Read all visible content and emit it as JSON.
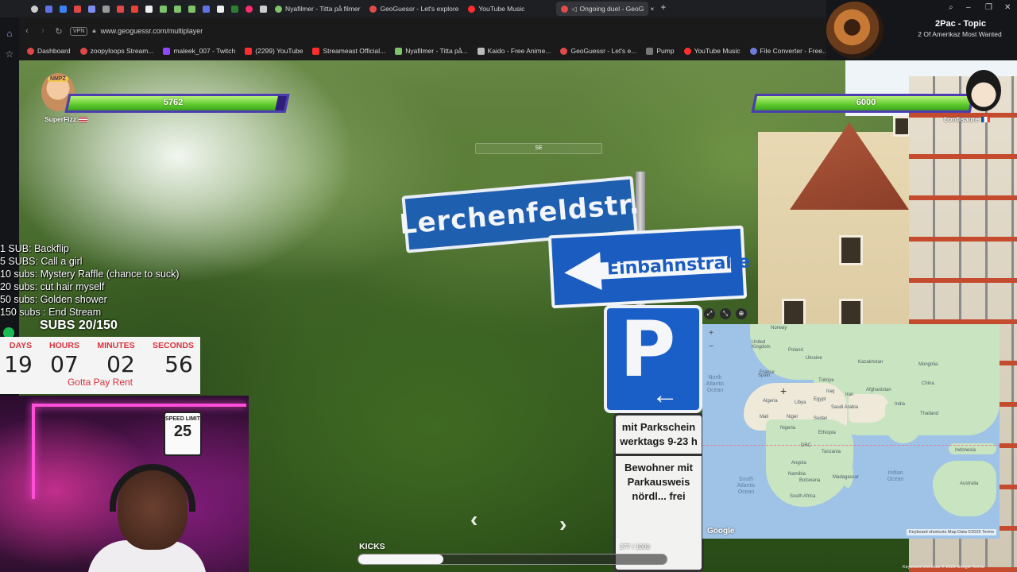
{
  "browser": {
    "tabs": [
      {
        "label": "Nyafilmer - Titta på filmer",
        "color": "#7cc36a",
        "active": false
      },
      {
        "label": "GeoGuessr - Let's explore",
        "color": "#e34b4b",
        "active": false
      },
      {
        "label": "YouTube Music",
        "color": "#ff2d2d",
        "active": false
      },
      {
        "label": "Ongoing duel - GeoG",
        "color": "#e34b4b",
        "active": true
      }
    ],
    "address": "www.geoguessr.com/multiplayer",
    "vpn_label": "VPN",
    "bookmarks": [
      {
        "label": "Dashboard",
        "color": "#e04848"
      },
      {
        "label": "zoopyloops Stream...",
        "color": "#e04848"
      },
      {
        "label": "maleek_007 - Twitch",
        "color": "#9146ff"
      },
      {
        "label": "(2299) YouTube",
        "color": "#ff2d2d"
      },
      {
        "label": "Streameast Official...",
        "color": "#ff2d2d"
      },
      {
        "label": "Nyafilmer - Titta på...",
        "color": "#7cc36a"
      },
      {
        "label": "Kaido - Free Anime...",
        "color": "#bbbbbb"
      },
      {
        "label": "GeoGuessr - Let's e...",
        "color": "#e34b4b"
      },
      {
        "label": "Pump",
        "color": "#777777"
      },
      {
        "label": "YouTube Music",
        "color": "#ff2d2d"
      },
      {
        "label": "File Converter - Free...",
        "color": "#6f7bd9"
      }
    ]
  },
  "music": {
    "title": "2Pac - Topic",
    "subtitle": "2 Of Amerikaz Most Wanted"
  },
  "game": {
    "compass_label": "SE",
    "player_left": {
      "name": "SuperFizz",
      "tag": "NMPZ",
      "health": 5762,
      "health_fraction": 0.9603
    },
    "player_right": {
      "name": "Lordisaure",
      "health": 6000,
      "health_fraction": 1.0
    },
    "street_sign": "Lerchenfeldstr.",
    "oneway_sign": "Einbahnstraße",
    "parking_text_1": "mit Parkschein werktags 9-23 h",
    "parking_text_2": "Bewohner mit Parkausweis nördl... frei"
  },
  "map": {
    "labels": {
      "norway": "Norway",
      "uk": "United Kingdom",
      "poland": "Poland",
      "ukraine": "Ukraine",
      "kazakhstan": "Kazakhstan",
      "mongolia": "Mongolia",
      "spain": "Spain",
      "france": "France",
      "turkiye": "Türkiye",
      "china": "China",
      "iraq": "Iraq",
      "afghanistan": "Afghanistan",
      "iran": "Iran",
      "algeria": "Algeria",
      "libya": "Libya",
      "egypt": "Egypt",
      "saudi": "Saudi Arabia",
      "india": "India",
      "thailand": "Thailand",
      "mali": "Mali",
      "niger": "Niger",
      "sudan": "Sudan",
      "ethiopia": "Ethiopia",
      "nigeria": "Nigeria",
      "drc": "DRC",
      "angola": "Angola",
      "tanzania": "Tanzania",
      "namibia": "Namibia",
      "botswana": "Botswana",
      "madagascar": "Madagascar",
      "south_africa": "South Africa",
      "indonesia": "Indonesia",
      "australia": "Australia"
    },
    "ocean_north_atlantic": "North Atlantic Ocean",
    "ocean_south_atlantic": "South Atlantic Ocean",
    "ocean_indian": "Indian Ocean",
    "google": "Google",
    "footer": "Keyboard shortcuts   Map Data ©2025   Terms"
  },
  "stream": {
    "sub_goals": [
      "1 SUB: Backflip",
      "5 SUBS: Call a girl",
      "10 subs: Mystery Raffle (chance to suck)",
      "20 subs: cut hair myself",
      "50 subs: Golden shower",
      "150 subs : End Stream"
    ],
    "subs_count": "SUBS 20/150",
    "timer": {
      "days_label": "DAYS",
      "hours_label": "HOURS",
      "minutes_label": "MINUTES",
      "seconds_label": "SECONDS",
      "days": "19",
      "hours": "07",
      "minutes": "02",
      "seconds": "56",
      "note": "Gotta Pay Rent"
    },
    "webcam_sign_a": "SPEED LIMIT",
    "webcam_sign_b": "25",
    "kicks_label": "KICKS",
    "kicks_count": "277 / 1000",
    "kicks_fraction": 0.277
  },
  "credits": "Keyboard shortcuts   © 2023 Google   Terms"
}
